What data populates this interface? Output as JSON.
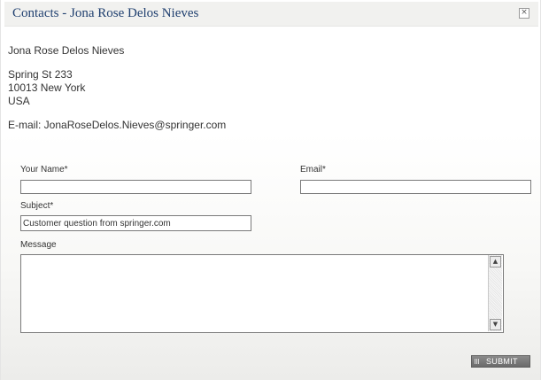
{
  "dialog": {
    "title": "Contacts - Jona Rose Delos Nieves",
    "close_icon": "×"
  },
  "contact": {
    "name": "Jona Rose Delos Nieves",
    "address_line1": "Spring St 233",
    "address_line2": "10013 New York",
    "country": "USA",
    "email_line": "E-mail: JonaRoseDelos.Nieves@springer.com"
  },
  "form": {
    "name_label": "Your Name*",
    "name_value": "",
    "email_label": "Email*",
    "email_value": "",
    "subject_label": "Subject*",
    "subject_value": "Customer question from springer.com",
    "message_label": "Message",
    "message_value": "",
    "submit_label": "SUBMIT"
  },
  "scrollbar": {
    "up_icon": "▲",
    "down_icon": "▼"
  }
}
